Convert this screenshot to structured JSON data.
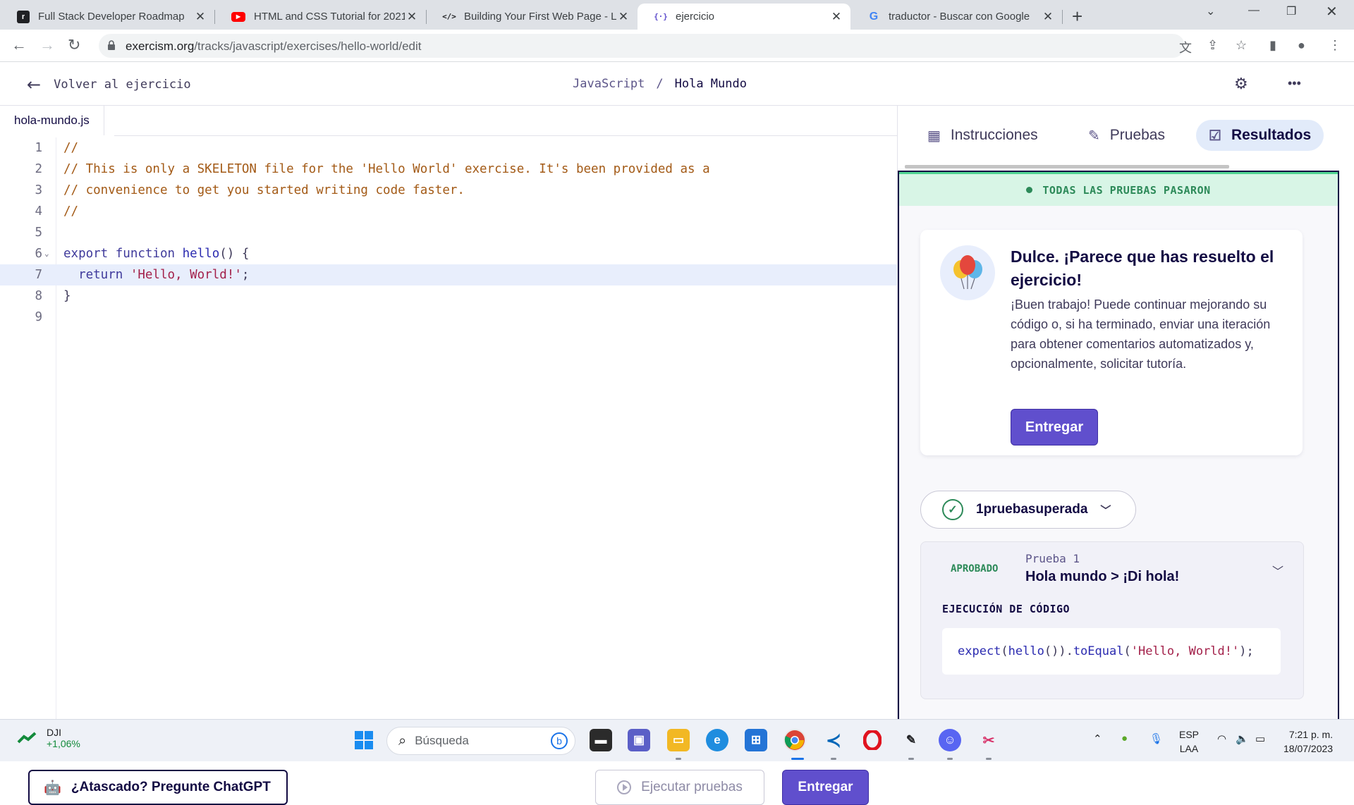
{
  "browser": {
    "tabs": [
      {
        "title": "Full Stack Developer Roadmap",
        "icon": "roadmap-logo-icon",
        "active": false
      },
      {
        "title": "HTML and CSS Tutorial for 2021",
        "icon": "youtube-logo-icon",
        "active": false
      },
      {
        "title": "Building Your First Web Page - Le",
        "icon": "code-tag-icon",
        "active": false
      },
      {
        "title": "ejercicio",
        "icon": "exercism-logo-icon",
        "active": true
      },
      {
        "title": "traductor - Buscar con Google",
        "icon": "google-logo-icon",
        "active": false
      }
    ],
    "url_host": "exercism.org",
    "url_path": "/tracks/javascript/exercises/hello-world/edit"
  },
  "header": {
    "back_label": "Volver al ejercicio",
    "track": "JavaScript",
    "separator": "/",
    "exercise": "Hola Mundo"
  },
  "editor": {
    "filename": "hola-mundo.js",
    "highlighted_line": 7,
    "lines": [
      {
        "num": "1",
        "text": "//"
      },
      {
        "num": "2",
        "text": "// This is only a SKELETON file for the 'Hello World' exercise. It's been provided as a"
      },
      {
        "num": "3",
        "text": "// convenience to get you started writing code faster."
      },
      {
        "num": "4",
        "text": "//"
      },
      {
        "num": "5",
        "text": ""
      },
      {
        "num": "6",
        "kw": "export function ",
        "fn": "hello",
        "rest": "() {"
      },
      {
        "num": "7",
        "kw": "  return ",
        "str": "'Hello, World!'",
        "rest": ";"
      },
      {
        "num": "8",
        "text": "}"
      },
      {
        "num": "9",
        "text": ""
      }
    ],
    "stuck_button": "¿Atascado? Pregunte ChatGPT",
    "run_button": "Ejecutar pruebas",
    "submit_button": "Entregar"
  },
  "panel": {
    "tabs": {
      "instructions": "Instrucciones",
      "tests": "Pruebas",
      "results": "Resultados"
    },
    "banner": "TODAS LAS PRUEBAS PASARON",
    "success_title": "Dulce. ¡Parece que has resuelto el ejercicio!",
    "success_body": "¡Buen trabajo! Puede continuar mejorando su código o, si ha terminado, enviar una iteración para obtener comentarios automatizados y, opcionalmente, solicitar tutoría.",
    "submit_button": "Entregar",
    "summary": "1pruebasuperada",
    "test": {
      "status": "APROBADO",
      "label": "Prueba 1",
      "name": "Hola mundo > ¡Di hola!",
      "exec_heading": "EJECUCIÓN DE CÓDIGO",
      "code_fn1": "expect",
      "code_p1": "(",
      "code_fn2": "hello",
      "code_p2": "()).",
      "code_fn3": "toEqual",
      "code_p3": "(",
      "code_str": "'Hello, World!'",
      "code_p4": ");"
    }
  },
  "taskbar": {
    "ticker_name": "DJI",
    "ticker_change": "+1,06%",
    "search_placeholder": "Búsqueda",
    "lang_top": "ESP",
    "lang_bottom": "LAA",
    "time": "7:21 p. m.",
    "date": "18/07/2023"
  },
  "colors": {
    "accent": "#604fcd",
    "success": "#2d8a59",
    "banner_bg": "#d8f5e6"
  }
}
